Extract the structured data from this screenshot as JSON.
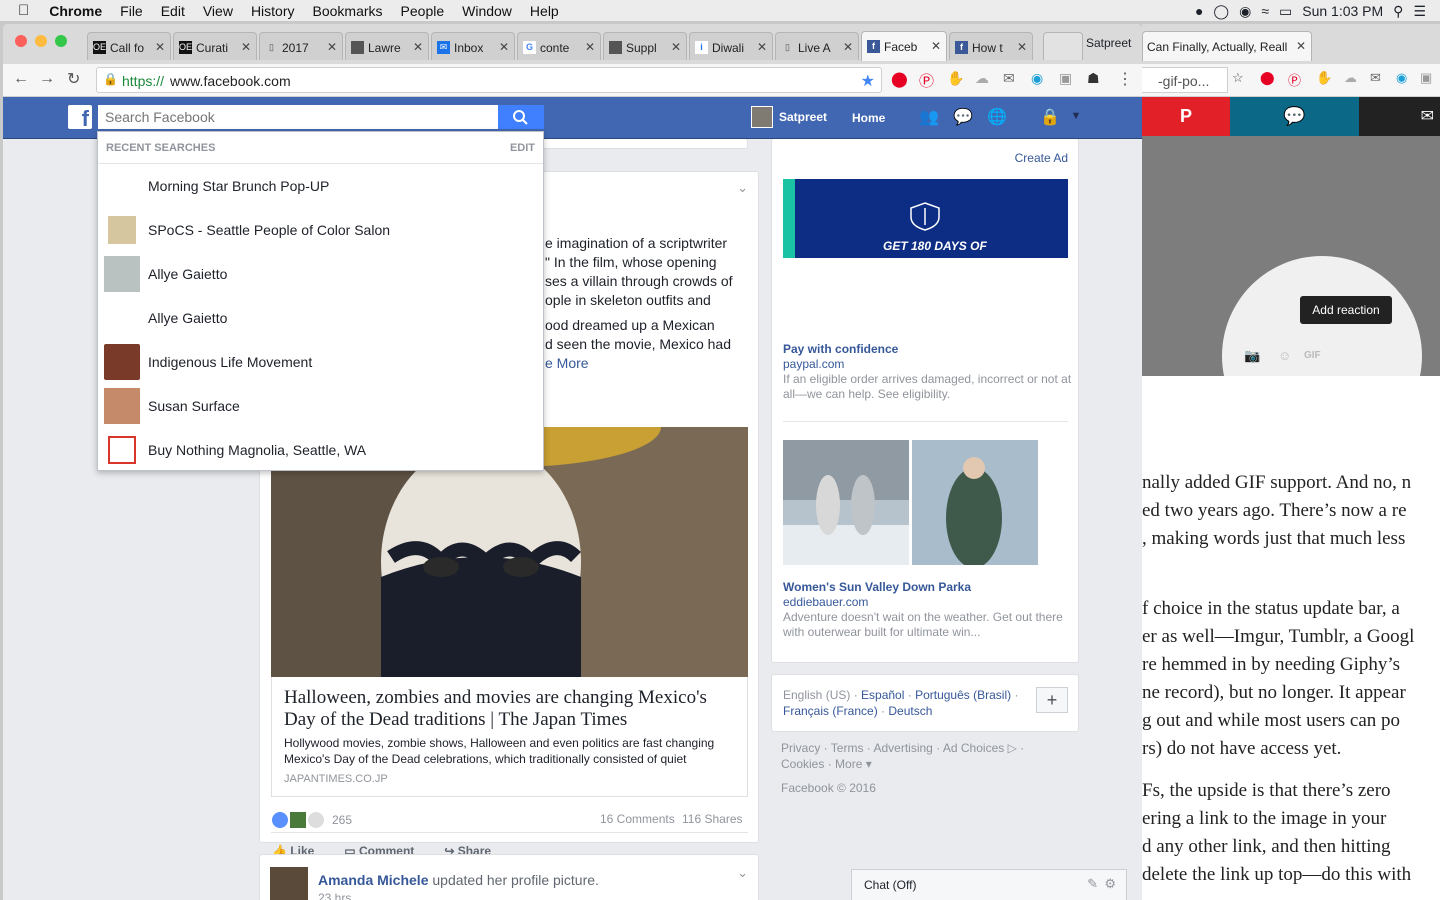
{
  "menubar": {
    "app": "Chrome",
    "items": [
      "File",
      "Edit",
      "View",
      "History",
      "Bookmarks",
      "People",
      "Window",
      "Help"
    ],
    "clock": "Sun 1:03 PM"
  },
  "tabs": [
    {
      "label": "Call fo",
      "icon": "OE"
    },
    {
      "label": "Curati",
      "icon": "OE"
    },
    {
      "label": "2017",
      "icon": "doc"
    },
    {
      "label": "Lawre",
      "icon": "box"
    },
    {
      "label": "Inbox",
      "icon": "mail"
    },
    {
      "label": "conte",
      "icon": "G"
    },
    {
      "label": "Suppl",
      "icon": "box"
    },
    {
      "label": "Diwali",
      "icon": "i"
    },
    {
      "label": "Live A",
      "icon": "doc"
    },
    {
      "label": "Faceb",
      "icon": "f"
    },
    {
      "label": "How t",
      "icon": "f"
    }
  ],
  "profile_name": "Satpreet",
  "url": {
    "scheme": "https://",
    "host": "www.facebook.com"
  },
  "fb": {
    "search_placeholder": "Search Facebook",
    "user": "Satpreet",
    "home": "Home",
    "recent_title": "RECENT SEARCHES",
    "edit": "EDIT",
    "recent": [
      {
        "label": "Morning Star Brunch Pop-UP"
      },
      {
        "label": "SPoCS - Seattle People of Color Salon"
      },
      {
        "label": "Allye Gaietto"
      },
      {
        "label": "Allye Gaietto"
      },
      {
        "label": "Indigenous Life Movement"
      },
      {
        "label": "Susan Surface"
      },
      {
        "label": "Buy Nothing Magnolia, Seattle, WA"
      }
    ],
    "post_text": [
      "e imagination of a scriptwriter",
      "\" In the film, whose opening",
      "ses a villain through crowds of",
      "ople in skeleton outfits and",
      "ood dreamed up a Mexican",
      "d seen the movie, Mexico had"
    ],
    "see_more": "e More",
    "article_title": "Halloween, zombies and movies are changing Mexico's Day of the Dead traditions | The Japan Times",
    "article_desc": "Hollywood movies, zombie shows, Halloween and even politics are fast changing Mexico's Day of the Dead celebrations, which traditionally consisted of quiet",
    "article_source": "JAPANTIMES.CO.JP",
    "reactions": "265",
    "comments": "16 Comments",
    "shares": "116 Shares",
    "like": "Like",
    "comment": "Comment",
    "share": "Share",
    "next_author": "Amanda Michele",
    "next_action": "updated her profile picture.",
    "next_time": "23 hrs"
  },
  "ads": {
    "create_ad": "Create Ad",
    "ad1_banner": "GET 180 DAYS OF",
    "ad1_title": "Pay with confidence",
    "ad1_domain": "paypal.com",
    "ad1_desc": "If an eligible order arrives damaged, incorrect or not at all—we can help. See eligibility.",
    "ad2_title": "Women's Sun Valley Down Parka",
    "ad2_domain": "eddiebauer.com",
    "ad2_desc": "Adventure doesn't wait on the weather. Get out there with outerwear built for ultimate win...",
    "langs_current": "English (US) ·",
    "langs": [
      "Español",
      "Português (Brasil)",
      "Français (France)",
      "Deutsch"
    ],
    "footer_links": [
      "Privacy",
      "Terms",
      "Advertising",
      "Ad Choices",
      "Cookies",
      "More"
    ],
    "copyright": "Facebook © 2016",
    "chat": "Chat (Off)"
  },
  "right": {
    "tab_label": "Can Finally, Actually, Reall",
    "url_frag": "-gif-po...",
    "tooltip": "Add reaction",
    "gif_label": "GIF",
    "lines1": [
      "nally added GIF support. And no, n",
      "ed two years ago. There’s now a re",
      ", making words just that much less"
    ],
    "lines2": [
      "f choice in the status update bar, a",
      "er as well—Imgur, Tumblr, a Googl",
      "re hemmed in by needing Giphy’s",
      "ne record), but no longer. It appear",
      "g out and while most users can po",
      "rs) do not have access yet."
    ],
    "lines3": [
      "Fs, the upside is that there’s zero",
      "ering a link to the image in your",
      "d any other link, and then hitting",
      "delete the link up top—do this with"
    ]
  },
  "colors": {
    "fb_blue": "#4267b2",
    "link": "#365899",
    "pinterest": "#e60023"
  }
}
